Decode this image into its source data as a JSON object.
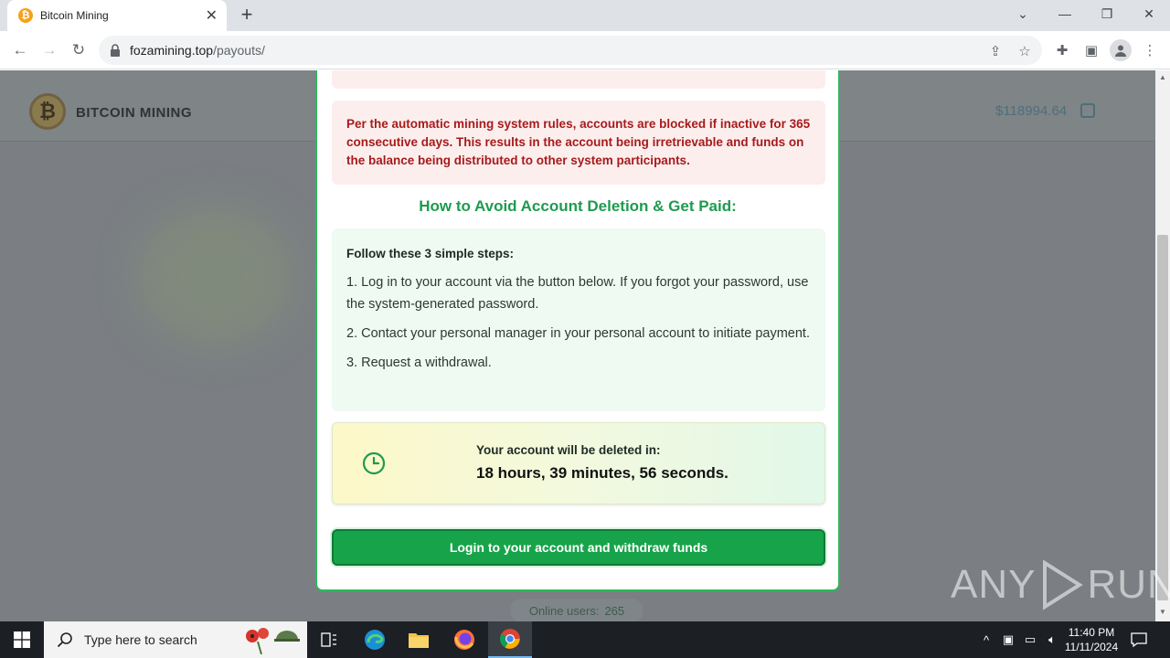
{
  "browser": {
    "tab_title": "Bitcoin Mining",
    "tab_favicon": "bitcoin-icon",
    "url_domain": "fozamining.top",
    "url_path": "/payouts/"
  },
  "site": {
    "brand": "BITCOIN MINING",
    "balance": "$118994.64",
    "online_label": "Online users:",
    "online_count": "265"
  },
  "modal": {
    "rules_text": "Per the automatic mining system rules, accounts are blocked if inactive for 365 consecutive days. This results in the account being irretrievable and funds on the balance being distributed to other system participants.",
    "howto_title": "How to Avoid Account Deletion & Get Paid:",
    "steps_heading": "Follow these 3 simple steps:",
    "steps": [
      "1. Log in to your account via the button below. If you forgot your password, use the system-generated password.",
      "2. Contact your personal manager in your personal account to initiate payment.",
      "3. Request a withdrawal."
    ],
    "countdown_label": "Your account will be deleted in:",
    "countdown_value": "18 hours, 39 minutes, 56 seconds.",
    "login_button": "Login to your account and withdraw funds"
  },
  "watermark": {
    "left": "ANY",
    "right": "RUN"
  },
  "taskbar": {
    "search_placeholder": "Type here to search",
    "time": "11:40 PM",
    "date": "11/11/2024"
  },
  "colors": {
    "accent_green": "#17a34a",
    "alert_red": "#a61b1b",
    "title_green": "#1e9b4e"
  }
}
